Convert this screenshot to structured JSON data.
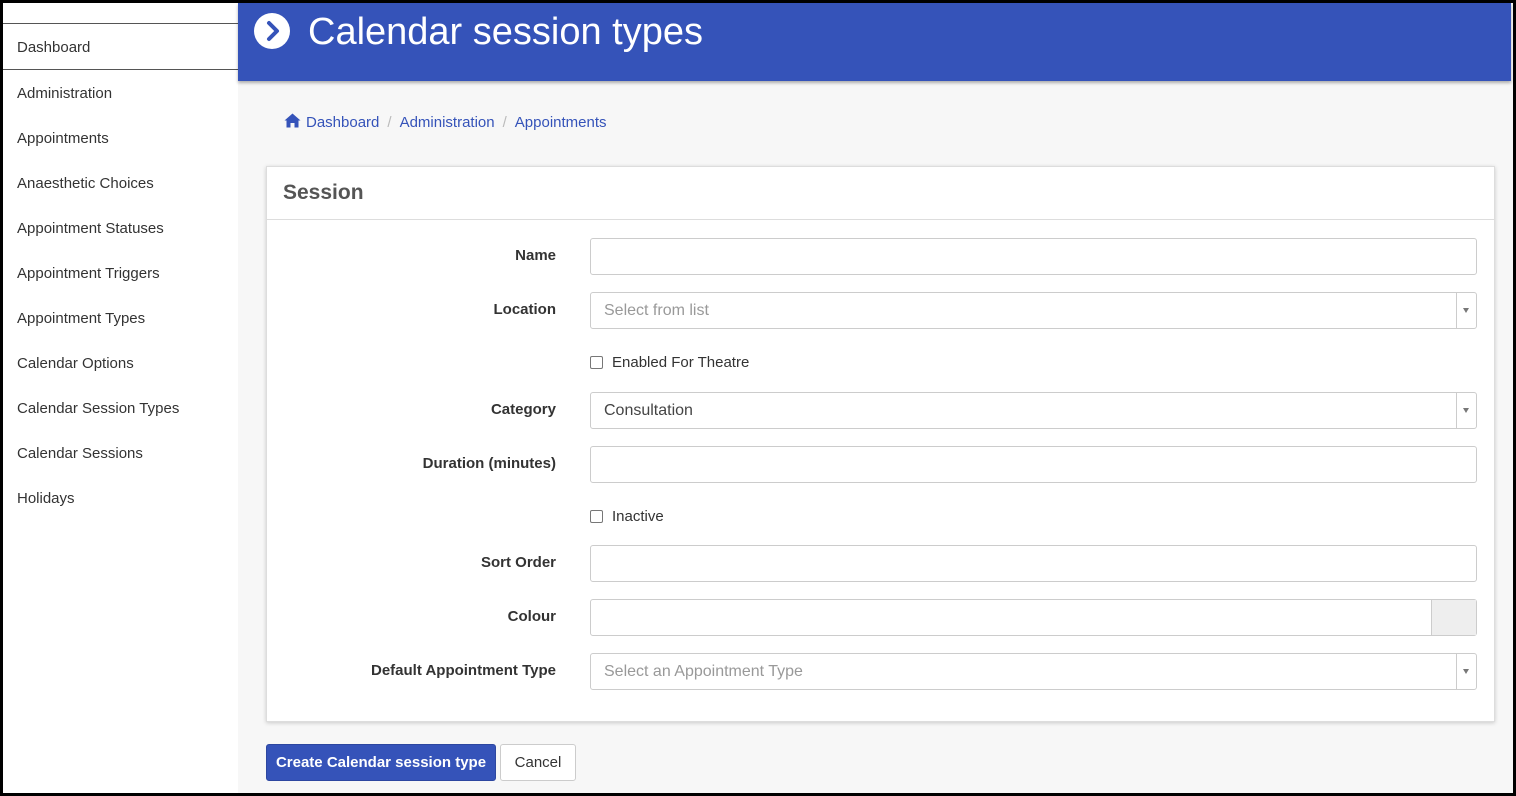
{
  "sidebar": {
    "items": [
      {
        "label": "Dashboard"
      },
      {
        "label": "Administration"
      },
      {
        "label": "Appointments"
      },
      {
        "label": "Anaesthetic Choices"
      },
      {
        "label": "Appointment Statuses"
      },
      {
        "label": "Appointment Triggers"
      },
      {
        "label": "Appointment Types"
      },
      {
        "label": "Calendar Options"
      },
      {
        "label": "Calendar Session Types"
      },
      {
        "label": "Calendar Sessions"
      },
      {
        "label": "Holidays"
      }
    ]
  },
  "header": {
    "title": "Calendar session types",
    "icon": "chevron-right-circle-icon"
  },
  "breadcrumb": {
    "items": [
      "Dashboard",
      "Administration",
      "Appointments"
    ],
    "separator": "/",
    "home_icon": "home-icon"
  },
  "form": {
    "panel_title": "Session",
    "name": {
      "label": "Name",
      "value": ""
    },
    "location": {
      "label": "Location",
      "placeholder": "Select from list"
    },
    "enabled_for_theatre": {
      "label": "Enabled For Theatre",
      "checked": false
    },
    "category": {
      "label": "Category",
      "value": "Consultation"
    },
    "duration": {
      "label": "Duration (minutes)",
      "value": ""
    },
    "inactive": {
      "label": "Inactive",
      "checked": false
    },
    "sort_order": {
      "label": "Sort Order",
      "value": ""
    },
    "colour": {
      "label": "Colour",
      "value": ""
    },
    "default_appointment_type": {
      "label": "Default Appointment Type",
      "placeholder": "Select an Appointment Type"
    }
  },
  "actions": {
    "create_label": "Create Calendar session type",
    "cancel_label": "Cancel"
  },
  "colors": {
    "primary": "#3553b9",
    "background": "#f7f7f7"
  }
}
